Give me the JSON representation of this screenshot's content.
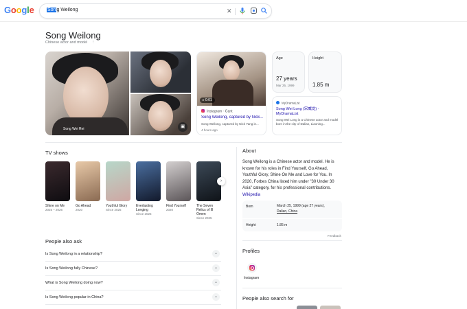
{
  "header": {
    "logo": "Google",
    "search_value_highlight": "Son",
    "search_value_rest": "g Weilong"
  },
  "entity": {
    "title": "Song Weilong",
    "subtitle": "Chinese actor and model",
    "more_icon": "⋮"
  },
  "images": {
    "main_caption": "Song Wei Rei"
  },
  "video": {
    "duration": "▸ 0:01",
    "source": "Instagram · Gant",
    "title": "Song Weilong, captured by Nick...",
    "description": "Song Weilong, captured by Nick Yang in...",
    "time": "4 hours ago"
  },
  "facts": {
    "age_label": "Age",
    "age_value": "27 years",
    "age_sub": "Mar 25, 1999",
    "height_label": "Height",
    "height_value": "1.85 m"
  },
  "mdl": {
    "source": "MyDramaList",
    "title": "Song Wei Long (宋威龙) - MyDramaList",
    "description": "Song Wei Long is a Chinese actor and model born in the city of Dalian, Liaoning..."
  },
  "tv_shows": {
    "title": "TV shows",
    "items": [
      {
        "name": "Shine on Me",
        "year": "2025 – 2026",
        "color1": "#3b2a2e",
        "color2": "#0e0c10"
      },
      {
        "name": "Go Ahead",
        "year": "2020",
        "color1": "#e8c9a8",
        "color2": "#8a6a52"
      },
      {
        "name": "Youthful Glory",
        "year": "Since 2025",
        "color1": "#b7d7c9",
        "color2": "#cfa7a3"
      },
      {
        "name": "Everlasting Longing",
        "year": "Since 2025",
        "color1": "#4b6fa0",
        "color2": "#12192b"
      },
      {
        "name": "Find Yourself",
        "year": "2020",
        "color1": "#d3cfcf",
        "color2": "#5b5558"
      },
      {
        "name": "The Seven Relics of Ill Omen",
        "year": "Since 2025",
        "color1": "#3c4957",
        "color2": "#0f1318"
      }
    ]
  },
  "paa": {
    "title": "People also ask",
    "questions": [
      "Is Song Weilong in a relationship?",
      "Is Song Weilong fully Chinese?",
      "What is Song Weilong doing now?",
      "Is Song Weilong popular in China?"
    ]
  },
  "about": {
    "title": "About",
    "text": "Song Weilong is a Chinese actor and model. He is known for his roles in Find Yourself, Go Ahead, Youthful Glory, Shine On Me and Love for You. In 2020, Forbes China listed him under \"30 Under 30 Asia\" category, for his professional contributions.",
    "link": "Wikipedia",
    "born_label": "Born",
    "born_value": "March 25, 1999 (age 27 years),",
    "born_place": "Dalian, China",
    "height_label": "Height",
    "height_value": "1.85 m",
    "feedback": "Feedback"
  },
  "profiles": {
    "title": "Profiles",
    "instagram": "Instagram"
  },
  "pas": {
    "title": "People also search for"
  }
}
